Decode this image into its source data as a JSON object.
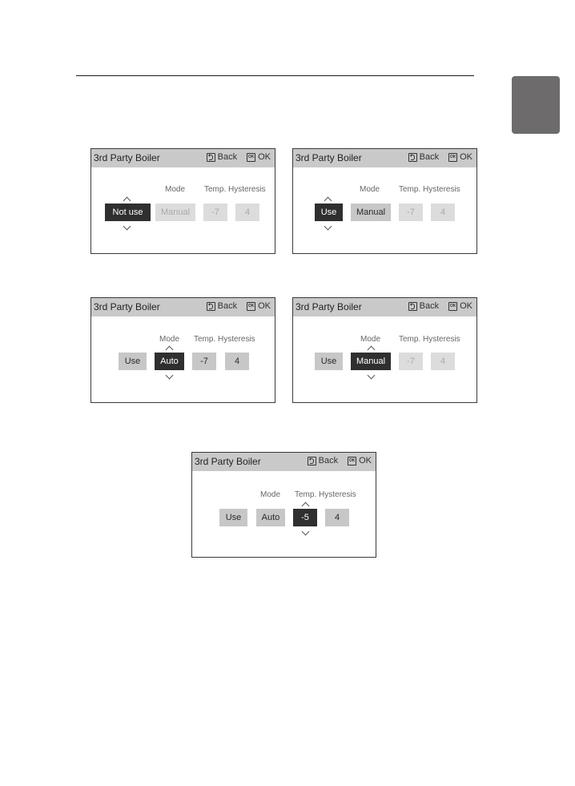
{
  "page": {
    "side_tab_color": "#6d6b6b"
  },
  "screens": [
    {
      "title": "3rd Party Boiler",
      "back_label": "Back",
      "ok_label": "OK",
      "ok_icon_text": "OK",
      "labels": {
        "mode": "Mode",
        "hysteresis": "Temp. Hysteresis"
      },
      "values": {
        "use": "Not use",
        "mode": "Manual",
        "temp": "-7",
        "hysteresis": "4"
      },
      "selected": "use"
    },
    {
      "title": "3rd Party Boiler",
      "back_label": "Back",
      "ok_label": "OK",
      "ok_icon_text": "OK",
      "labels": {
        "mode": "Mode",
        "hysteresis": "Temp. Hysteresis"
      },
      "values": {
        "use": "Use",
        "mode": "Manual",
        "temp": "-7",
        "hysteresis": "4"
      },
      "selected": "use"
    },
    {
      "title": "3rd Party Boiler",
      "back_label": "Back",
      "ok_label": "OK",
      "ok_icon_text": "OK",
      "labels": {
        "mode": "Mode",
        "hysteresis": "Temp. Hysteresis"
      },
      "values": {
        "use": "Use",
        "mode": "Auto",
        "temp": "-7",
        "hysteresis": "4"
      },
      "selected": "mode"
    },
    {
      "title": "3rd Party Boiler",
      "back_label": "Back",
      "ok_label": "OK",
      "ok_icon_text": "OK",
      "labels": {
        "mode": "Mode",
        "hysteresis": "Temp. Hysteresis"
      },
      "values": {
        "use": "Use",
        "mode": "Manual",
        "temp": "-7",
        "hysteresis": "4"
      },
      "selected": "mode"
    },
    {
      "title": "3rd Party Boiler",
      "back_label": "Back",
      "ok_label": "OK",
      "ok_icon_text": "OK",
      "labels": {
        "mode": "Mode",
        "hysteresis": "Temp. Hysteresis"
      },
      "values": {
        "use": "Use",
        "mode": "Auto",
        "temp": "-5",
        "hysteresis": "4"
      },
      "selected": "temp"
    }
  ]
}
